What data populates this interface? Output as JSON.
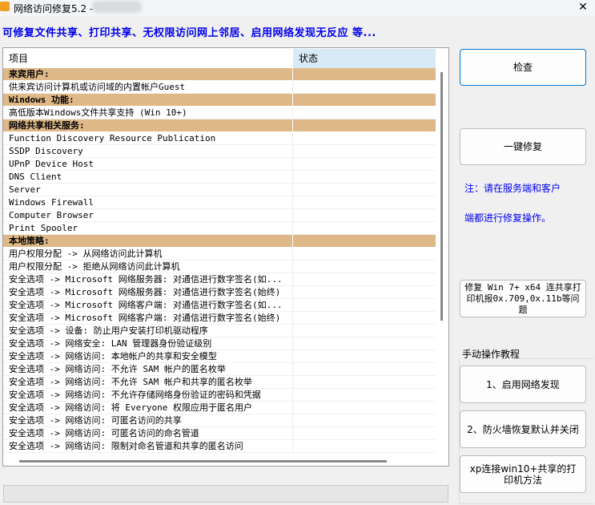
{
  "window": {
    "title": "网络访问修复5.2 -",
    "close_glyph": "✕"
  },
  "subtitle": "可修复文件共享、打印共享、无权限访问网上邻居、启用网络发现无反应   等...",
  "table": {
    "columns": [
      "项目",
      "状态"
    ],
    "rows": [
      {
        "label": "来宾用户:",
        "group": true
      },
      {
        "label": "供来宾访问计算机或访问域的内置帐户Guest"
      },
      {
        "label": "Windows 功能:",
        "group": true
      },
      {
        "label": "高低版本Windows文件共享支持 (Win 10+)"
      },
      {
        "label": "网络共享相关服务:",
        "group": true
      },
      {
        "label": "Function Discovery Resource Publication"
      },
      {
        "label": "SSDP Discovery"
      },
      {
        "label": "UPnP Device Host"
      },
      {
        "label": "DNS Client"
      },
      {
        "label": "Server"
      },
      {
        "label": "Windows Firewall"
      },
      {
        "label": "Computer Browser"
      },
      {
        "label": "Print Spooler"
      },
      {
        "label": "本地策略:",
        "group": true
      },
      {
        "label": "用户权限分配 -> 从网络访问此计算机"
      },
      {
        "label": "用户权限分配 -> 拒绝从网络访问此计算机"
      },
      {
        "label": "安全选项 -> Microsoft 网络服务器: 对通信进行数字签名(如..."
      },
      {
        "label": "安全选项 -> Microsoft 网络服务器: 对通信进行数字签名(始终)"
      },
      {
        "label": "安全选项 -> Microsoft 网络客户端: 对通信进行数字签名(如..."
      },
      {
        "label": "安全选项 -> Microsoft 网络客户端: 对通信进行数字签名(始终)"
      },
      {
        "label": "安全选项 -> 设备: 防止用户安装打印机驱动程序"
      },
      {
        "label": "安全选项 -> 网络安全: LAN 管理器身份验证级别"
      },
      {
        "label": "安全选项 -> 网络访问: 本地帐户的共享和安全模型"
      },
      {
        "label": "安全选项 -> 网络访问: 不允许 SAM 帐户的匿名枚举"
      },
      {
        "label": "安全选项 -> 网络访问: 不允许 SAM 帐户和共享的匿名枚举"
      },
      {
        "label": "安全选项 -> 网络访问: 不允许存储网络身份验证的密码和凭据"
      },
      {
        "label": "安全选项 -> 网络访问: 将 Everyone 权限应用于匿名用户"
      },
      {
        "label": "安全选项 -> 网络访问: 可匿名访问的共享"
      },
      {
        "label": "安全选项 -> 网络访问: 可匿名访问的命名管道"
      },
      {
        "label": "安全选项 -> 网络访问: 限制对命名管道和共享的匿名访问"
      }
    ]
  },
  "buttons": {
    "check": "检查",
    "one_click_fix": "一键修复",
    "printer_fix": "修复 Win 7+ x64 连共享打印机报0x.709,0x.11b等问题"
  },
  "note": [
    "注：请在服务端和客户",
    "端都进行修复操作。"
  ],
  "tutorial": {
    "label": "手动操作教程",
    "items": [
      "1、启用网络发现",
      "2、防火墙恢复默认并关闭",
      "xp连接win10+共享的打印机方法"
    ]
  },
  "colors": {
    "group_row": "#deb887",
    "accent_text": "#0000ee",
    "header_status": "#d9eaf7"
  }
}
